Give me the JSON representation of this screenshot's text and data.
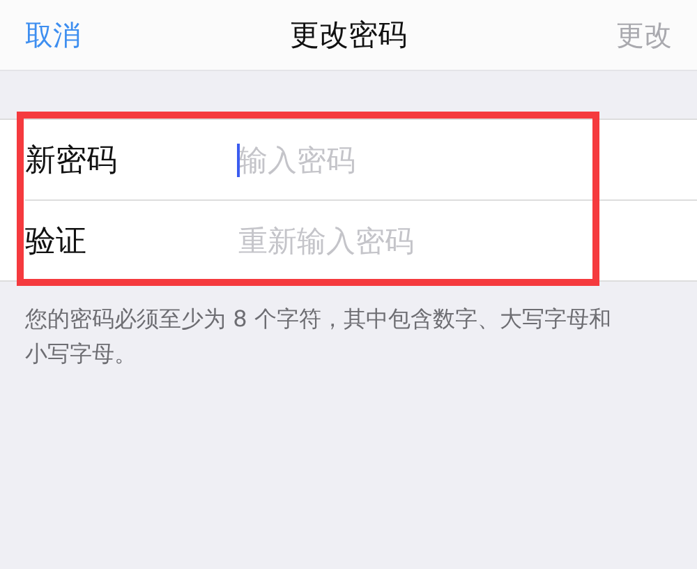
{
  "nav": {
    "cancel": "取消",
    "title": "更改密码",
    "done": {
      "label": "更改",
      "disabled": true
    }
  },
  "fields": [
    {
      "label": "新密码",
      "placeholder": "输入密码",
      "focused": true
    },
    {
      "label": "验证",
      "placeholder": "重新输入密码",
      "focused": false
    }
  ],
  "highlight": true,
  "footer": "您的密码必须至少为 8 个字符，其中包含数字、大写字母和小写字母。"
}
